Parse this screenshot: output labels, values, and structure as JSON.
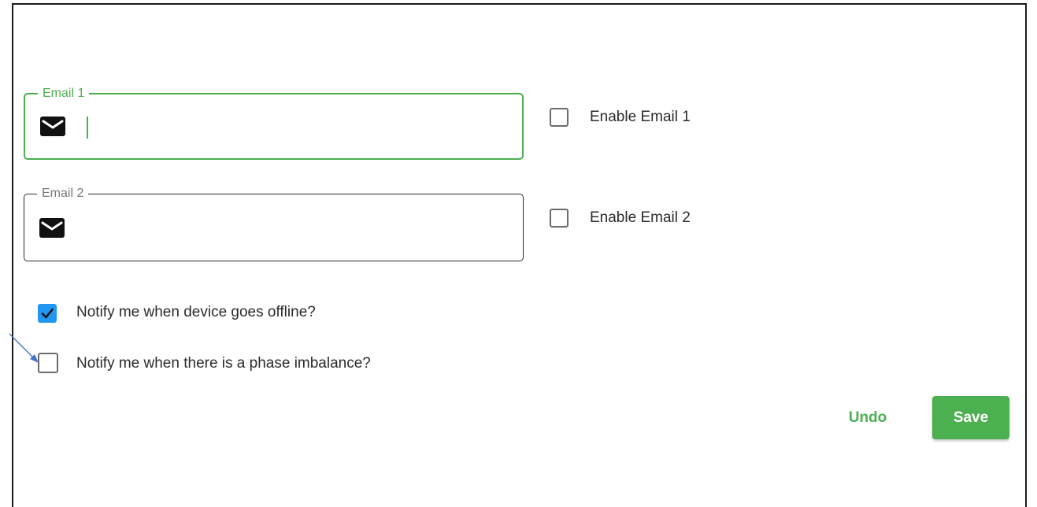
{
  "form": {
    "email1": {
      "label": "Email 1",
      "value": "",
      "icon": "email-icon",
      "focused": true
    },
    "email2": {
      "label": "Email 2",
      "value": "",
      "icon": "email-icon",
      "focused": false
    },
    "enable_email1": {
      "label": "Enable Email 1",
      "checked": false
    },
    "enable_email2": {
      "label": "Enable Email 2",
      "checked": false
    },
    "notify_offline": {
      "label": "Notify me when device goes offline?",
      "checked": true
    },
    "notify_phase": {
      "label": "Notify me when there is a phase imbalance?",
      "checked": false
    }
  },
  "actions": {
    "undo_label": "Undo",
    "save_label": "Save"
  },
  "colors": {
    "accent": "#4caf50",
    "checkbox_checked": "#2196f3",
    "annotation_arrow": "#4472c4"
  }
}
